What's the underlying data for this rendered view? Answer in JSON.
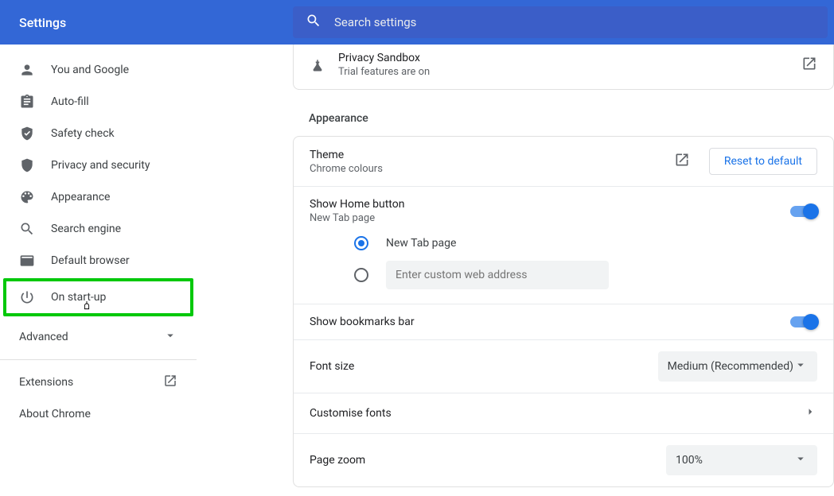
{
  "header": {
    "title": "Settings",
    "search_placeholder": "Search settings"
  },
  "sidebar": {
    "items": [
      {
        "label": "You and Google"
      },
      {
        "label": "Auto-fill"
      },
      {
        "label": "Safety check"
      },
      {
        "label": "Privacy and security"
      },
      {
        "label": "Appearance"
      },
      {
        "label": "Search engine"
      },
      {
        "label": "Default browser"
      },
      {
        "label": "On start-up"
      }
    ],
    "advanced": "Advanced",
    "extensions": "Extensions",
    "about": "About Chrome"
  },
  "privacy_sandbox": {
    "title": "Privacy Sandbox",
    "subtitle": "Trial features are on"
  },
  "appearance": {
    "section": "Appearance",
    "theme": {
      "title": "Theme",
      "subtitle": "Chrome colours",
      "reset": "Reset to default"
    },
    "home": {
      "title": "Show Home button",
      "subtitle": "New Tab page",
      "opt_newtab": "New Tab page",
      "custom_placeholder": "Enter custom web address"
    },
    "bookmarks": {
      "title": "Show bookmarks bar"
    },
    "fontsize": {
      "title": "Font size",
      "value": "Medium (Recommended)"
    },
    "customfonts": {
      "title": "Customise fonts"
    },
    "zoom": {
      "title": "Page zoom",
      "value": "100%"
    }
  }
}
